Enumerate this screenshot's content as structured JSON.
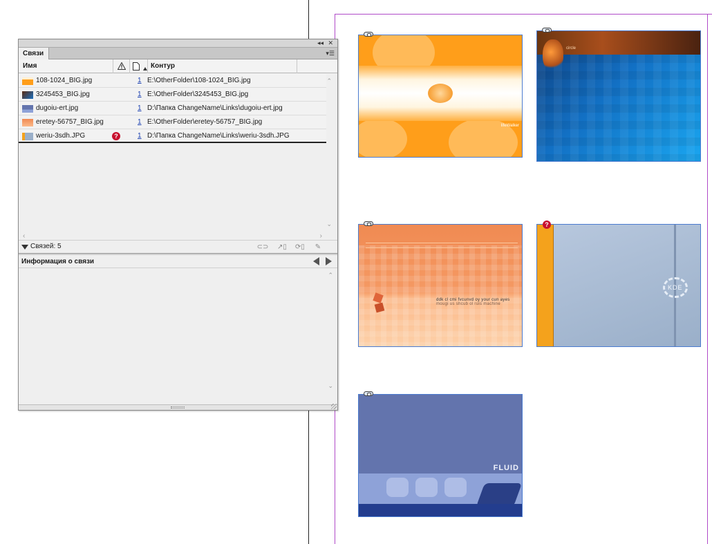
{
  "panel": {
    "title_buttons": {
      "collapse": "◂◂",
      "close": "✕"
    },
    "tab_label": "Связи",
    "menu_icon": "panel-menu-icon",
    "columns": {
      "name": "Имя",
      "status_icon": "warning-icon",
      "page_icon": "page-icon",
      "sort_icon": "sort-ascending-icon",
      "path": "Контур"
    },
    "links": [
      {
        "name": "108-1024_BIG.jpg",
        "page": "1",
        "path": "E:\\OtherFolder\\108-1024_BIG.jpg",
        "thumb_color": "#ff9e1a",
        "missing": false
      },
      {
        "name": "3245453_BIG.jpg",
        "page": "1",
        "path": "E:\\OtherFolder\\3245453_BIG.jpg",
        "thumb_color": "#1a6fc0",
        "missing": false
      },
      {
        "name": "dugoiu-ert.jpg",
        "page": "1",
        "path": "D:\\Папка ChangeName\\Links\\dugoiu-ert.jpg",
        "thumb_color": "#6374ad",
        "missing": false
      },
      {
        "name": "eretey-56757_BIG.jpg",
        "page": "1",
        "path": "E:\\OtherFolder\\eretey-56757_BIG.jpg",
        "thumb_color": "#f08a52",
        "missing": false
      },
      {
        "name": "weriu-3sdh.JPG",
        "page": "1",
        "path": "D:\\Папка ChangeName\\Links\\weriu-3sdh.JPG",
        "thumb_color": "#9aafc9",
        "missing": true,
        "missing_glyph": "?"
      }
    ],
    "status_text": "Связей: 5",
    "tools": [
      "relink-icon",
      "go-to-link-icon",
      "update-link-icon",
      "edit-original-icon"
    ],
    "info_title": "Информация о связи"
  },
  "page_images": [
    {
      "file": "108-1024_BIG.jpg",
      "tag_text": "lifeWalker",
      "missing": false
    },
    {
      "file": "3245453_BIG.jpg",
      "word": "circle",
      "missing": false
    },
    {
      "file": "eretey-56757_BIG.jpg",
      "caption_lines": [
        "ddk cl cmi fvcunvd oy your cun ayes",
        "mougi us shcub ol ruis machine"
      ],
      "missing": false
    },
    {
      "file": "weriu-3sdh.JPG",
      "logo": "KDE",
      "missing": true,
      "missing_glyph": "?"
    },
    {
      "file": "dugoiu-ert.jpg",
      "logo": "FLUID",
      "missing": false
    }
  ]
}
